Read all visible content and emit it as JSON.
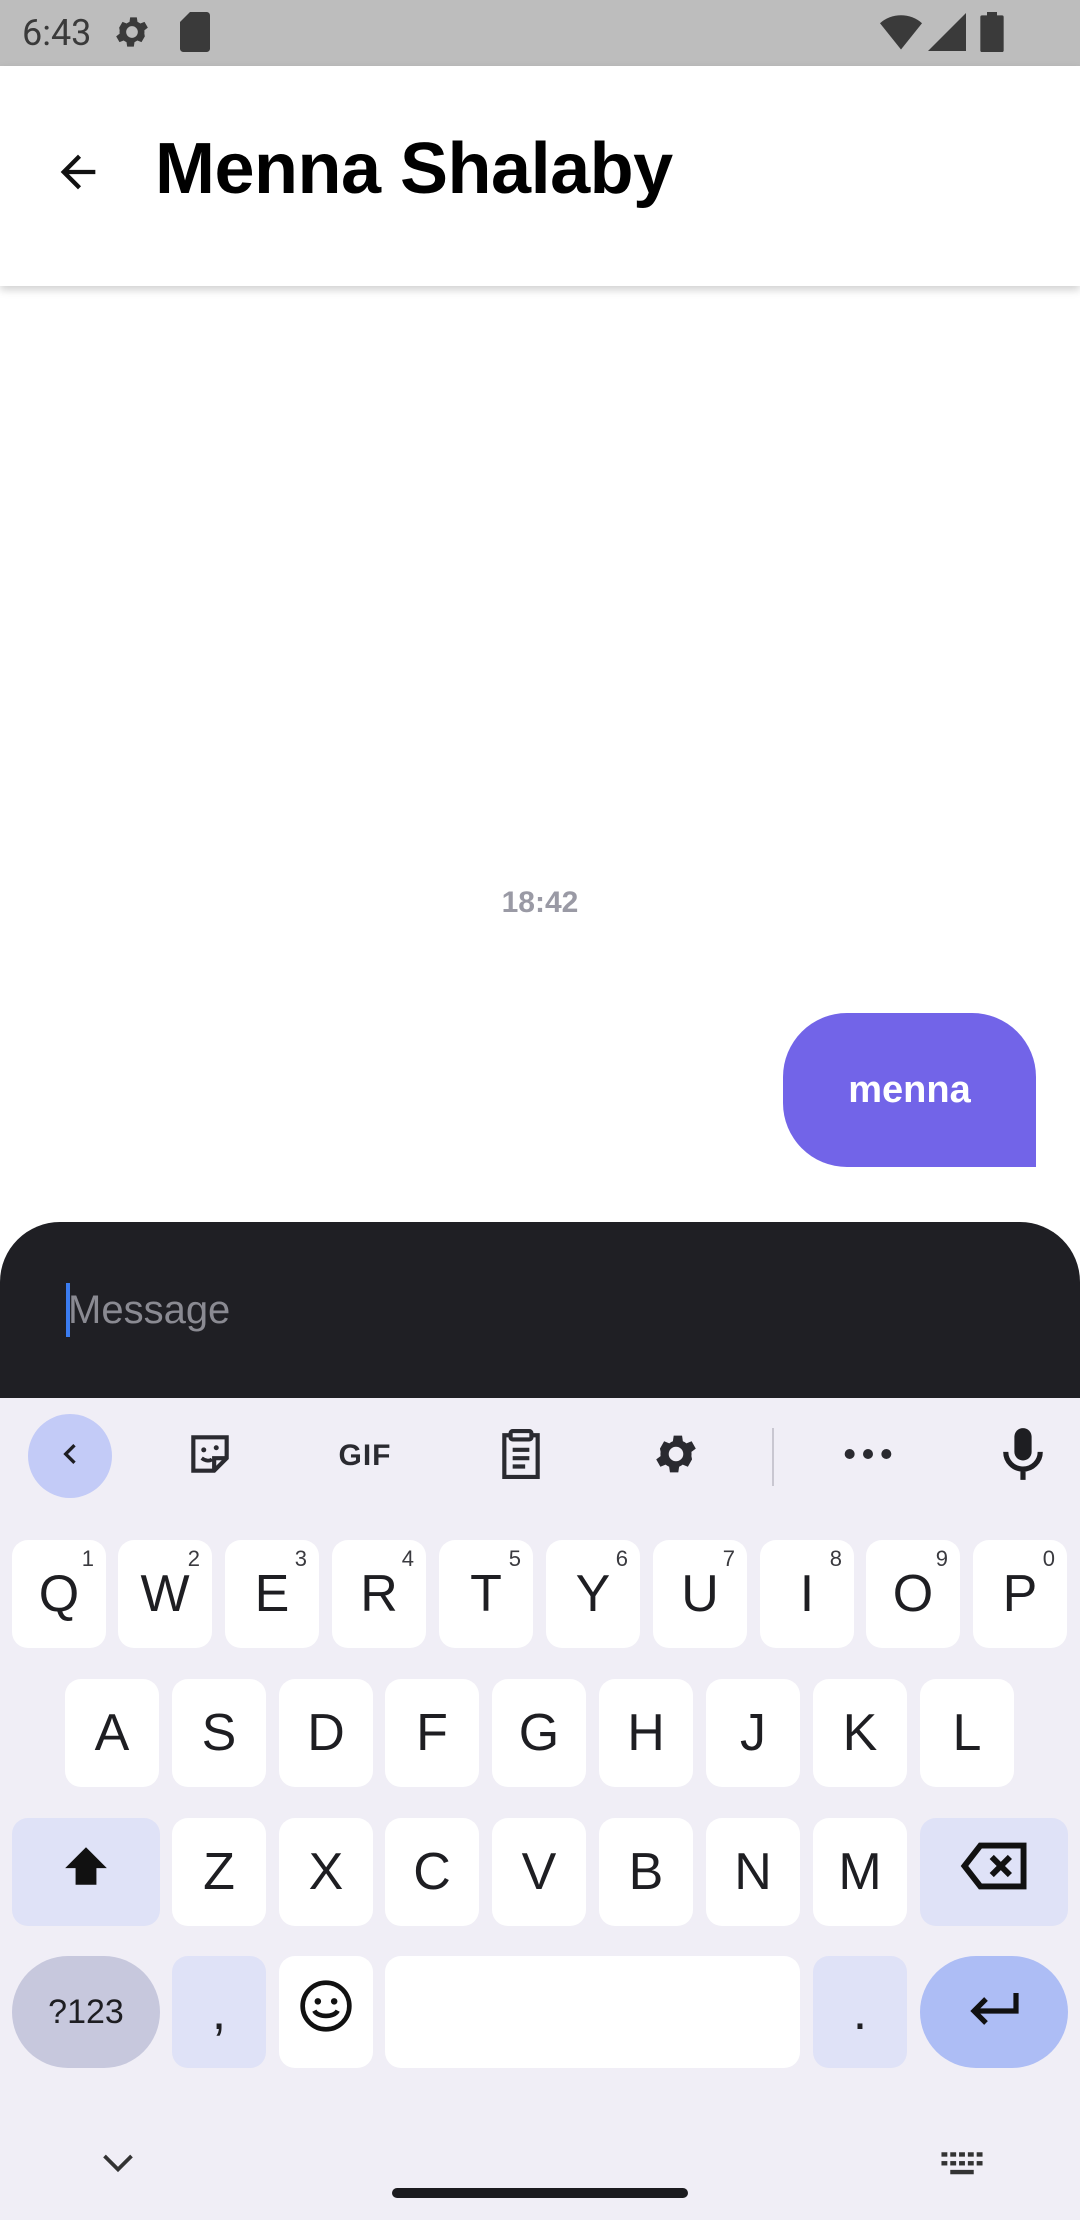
{
  "status_bar": {
    "time": "6:43",
    "icons": [
      "settings-icon",
      "sd-card-icon",
      "wifi-icon",
      "signal-icon",
      "battery-icon"
    ]
  },
  "app_bar": {
    "title": "Menna Shalaby",
    "back_icon": "arrow-back-icon"
  },
  "chat": {
    "timestamp": "18:42",
    "messages": [
      {
        "text": "menna",
        "from": "me"
      }
    ]
  },
  "composer": {
    "placeholder": "Message",
    "value": ""
  },
  "keyboard": {
    "toolbar": {
      "collapse_icon": "chevron-left-icon",
      "sticker_icon": "sticker-icon",
      "gif_label": "GIF",
      "clipboard_icon": "clipboard-icon",
      "settings_icon": "gear-icon",
      "more_icon": "more-icon",
      "mic_icon": "microphone-icon"
    },
    "row1": [
      {
        "key": "Q",
        "hint": "1"
      },
      {
        "key": "W",
        "hint": "2"
      },
      {
        "key": "E",
        "hint": "3"
      },
      {
        "key": "R",
        "hint": "4"
      },
      {
        "key": "T",
        "hint": "5"
      },
      {
        "key": "Y",
        "hint": "6"
      },
      {
        "key": "U",
        "hint": "7"
      },
      {
        "key": "I",
        "hint": "8"
      },
      {
        "key": "O",
        "hint": "9"
      },
      {
        "key": "P",
        "hint": "0"
      }
    ],
    "row2": [
      "A",
      "S",
      "D",
      "F",
      "G",
      "H",
      "J",
      "K",
      "L"
    ],
    "row3": [
      "Z",
      "X",
      "C",
      "V",
      "B",
      "N",
      "M"
    ],
    "symbols_label": "?123",
    "comma_label": ",",
    "period_label": ".",
    "colors": {
      "background": "#f0eef6",
      "function_key": "#dfe2f7",
      "enter_key": "#adbdf5",
      "accent": "#7264e8"
    }
  }
}
